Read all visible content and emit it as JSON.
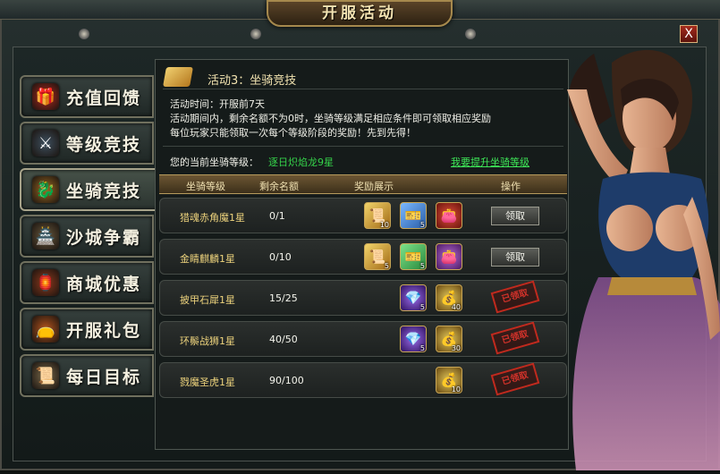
{
  "window": {
    "title": "开服活动",
    "close_label": "X"
  },
  "sidebar": {
    "items": [
      {
        "label": "充值回馈",
        "icon": "gift-icon",
        "color": "#b2281e",
        "glyph": "🎁"
      },
      {
        "label": "等级竞技",
        "icon": "crossed-swords-icon",
        "color": "#3d4f5e",
        "glyph": "⚔"
      },
      {
        "label": "坐骑竞技",
        "icon": "dragon-mount-icon",
        "color": "#9c6a22",
        "glyph": "🐉",
        "active": true
      },
      {
        "label": "沙城争霸",
        "icon": "castle-icon",
        "color": "#6a5a3e",
        "glyph": "🏯"
      },
      {
        "label": "商城优惠",
        "icon": "shop-icon",
        "color": "#8e3a1c",
        "glyph": "🏮"
      },
      {
        "label": "开服礼包",
        "icon": "gift-bag-icon",
        "color": "#b5541c",
        "glyph": "👝"
      },
      {
        "label": "每日目标",
        "icon": "scroll-icon",
        "color": "#7a6a4a",
        "glyph": "📜"
      }
    ]
  },
  "activity": {
    "title": "活动3：坐骑竞技",
    "time": "活动时间：开服前7天",
    "desc1": "活动期间内，剩余名额不为0时，坐骑等级满足相应条件即可领取相应奖励",
    "desc2": "每位玩家只能领取一次每个等级阶段的奖励！先到先得！",
    "current_label": "您的当前坐骑等级：",
    "current_value": "逐日炽焰龙9星",
    "upgrade_link": "我要提升坐骑等级"
  },
  "table": {
    "headers": [
      "坐骑等级",
      "剩余名额",
      "奖励展示",
      "操作"
    ],
    "claim_label": "领取",
    "claimed_label": "已领取",
    "rows": [
      {
        "level": "猎魂赤角魔1星",
        "remaining": "0/1",
        "rewards": [
          {
            "icon": "gold-scroll-icon",
            "qty": "10"
          },
          {
            "icon": "blue-ticket-icon",
            "qty": "5"
          },
          {
            "icon": "red-bag-icon",
            "qty": ""
          }
        ],
        "status": "claim"
      },
      {
        "level": "金睛麒麟1星",
        "remaining": "0/10",
        "rewards": [
          {
            "icon": "gold-scroll-icon",
            "qty": "5"
          },
          {
            "icon": "green-ticket-icon",
            "qty": "5"
          },
          {
            "icon": "purple-bag-icon",
            "qty": ""
          }
        ],
        "status": "claim"
      },
      {
        "level": "披甲石犀1星",
        "remaining": "15/25",
        "rewards": [
          {
            "icon": "purple-gem-icon",
            "qty": "5"
          },
          {
            "icon": "gold-gem-chest-icon",
            "qty": "40"
          }
        ],
        "status": "claimed"
      },
      {
        "level": "环鬃战狮1星",
        "remaining": "40/50",
        "rewards": [
          {
            "icon": "purple-gem-icon",
            "qty": "5"
          },
          {
            "icon": "gold-gem-chest-icon",
            "qty": "30"
          }
        ],
        "status": "claimed"
      },
      {
        "level": "戮魔圣虎1星",
        "remaining": "90/100",
        "rewards": [
          {
            "icon": "gold-gem-chest-icon",
            "qty": "10"
          }
        ],
        "status": "claimed"
      }
    ]
  }
}
